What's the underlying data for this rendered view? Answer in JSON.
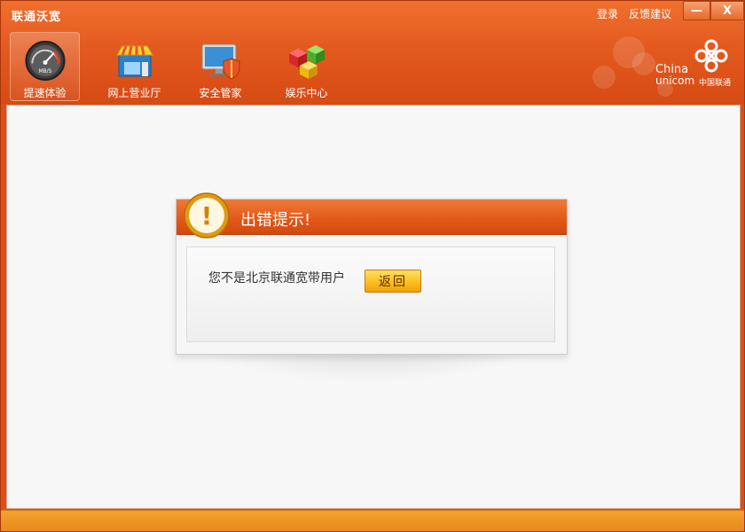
{
  "window": {
    "title": "联通沃宽",
    "links": {
      "login": "登录",
      "feedback": "反馈建议"
    },
    "controls": {
      "minimize": "—",
      "close": "X"
    }
  },
  "nav": {
    "items": [
      {
        "label": "提速体验",
        "icon": "speedometer-icon",
        "active": true
      },
      {
        "label": "网上营业厅",
        "icon": "storefront-icon",
        "active": false
      },
      {
        "label": "安全管家",
        "icon": "monitor-shield-icon",
        "active": false
      },
      {
        "label": "娱乐中心",
        "icon": "colored-cubes-icon",
        "active": false
      }
    ],
    "speedometer_unit": "MB/S"
  },
  "brand": {
    "line1": "China",
    "line2": "unicom",
    "cn": "中国联通"
  },
  "dialog": {
    "title": "出错提示!",
    "message": "您不是北京联通宽带用户",
    "button": "返回",
    "icon_symbol": "!"
  },
  "colors": {
    "accent": "#e35a1f",
    "button": "#fcbf1d",
    "footer": "#f5a12f"
  }
}
